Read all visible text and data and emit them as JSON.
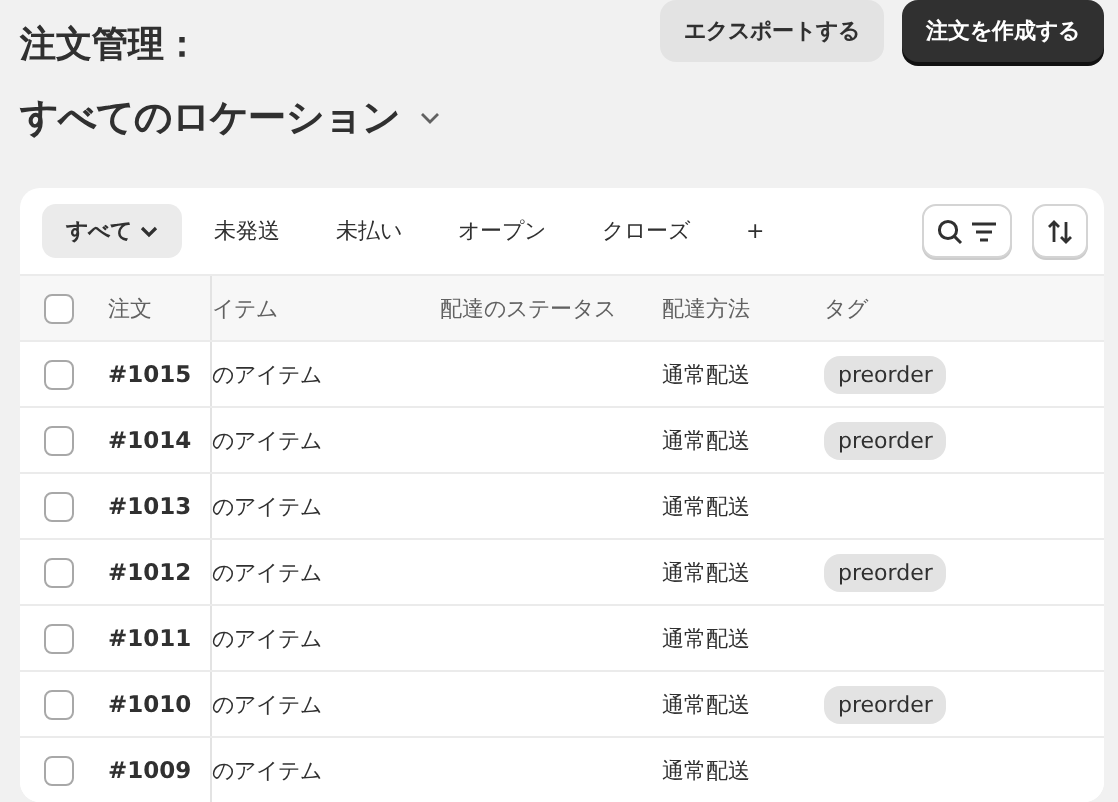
{
  "header": {
    "title": "注文管理：",
    "buttons": [
      {
        "label": "エクスポートする",
        "kind": "secondary"
      },
      {
        "label": "注文を作成する",
        "kind": "primary"
      }
    ],
    "location": "すべてのロケーション"
  },
  "filters": {
    "tabs": [
      {
        "label": "すべて",
        "selected": true
      },
      {
        "label": "未発送",
        "selected": false
      },
      {
        "label": "未払い",
        "selected": false
      },
      {
        "label": "オープン",
        "selected": false
      },
      {
        "label": "クローズ",
        "selected": false
      }
    ],
    "add": "+"
  },
  "table": {
    "select_all": false,
    "columns": [
      "注文",
      "イテム",
      "配達のステータス",
      "配達方法",
      "タグ"
    ],
    "rows": [
      {
        "order": "#1015",
        "items": "のアイテム",
        "method": "通常配送",
        "tag": "preorder",
        "checked": false
      },
      {
        "order": "#1014",
        "items": "のアイテム",
        "method": "通常配送",
        "tag": "preorder",
        "checked": false
      },
      {
        "order": "#1013",
        "items": "のアイテム",
        "method": "通常配送",
        "checked": false
      },
      {
        "order": "#1012",
        "items": "のアイテム",
        "method": "通常配送",
        "tag": "preorder",
        "checked": false
      },
      {
        "order": "#1011",
        "items": "のアイテム",
        "method": "通常配送",
        "checked": false
      },
      {
        "order": "#1010",
        "items": "のアイテム",
        "method": "通常配送",
        "tag": "preorder",
        "checked": false
      },
      {
        "order": "#1009",
        "items": "のアイテム",
        "method": "通常配送",
        "checked": false
      }
    ]
  }
}
